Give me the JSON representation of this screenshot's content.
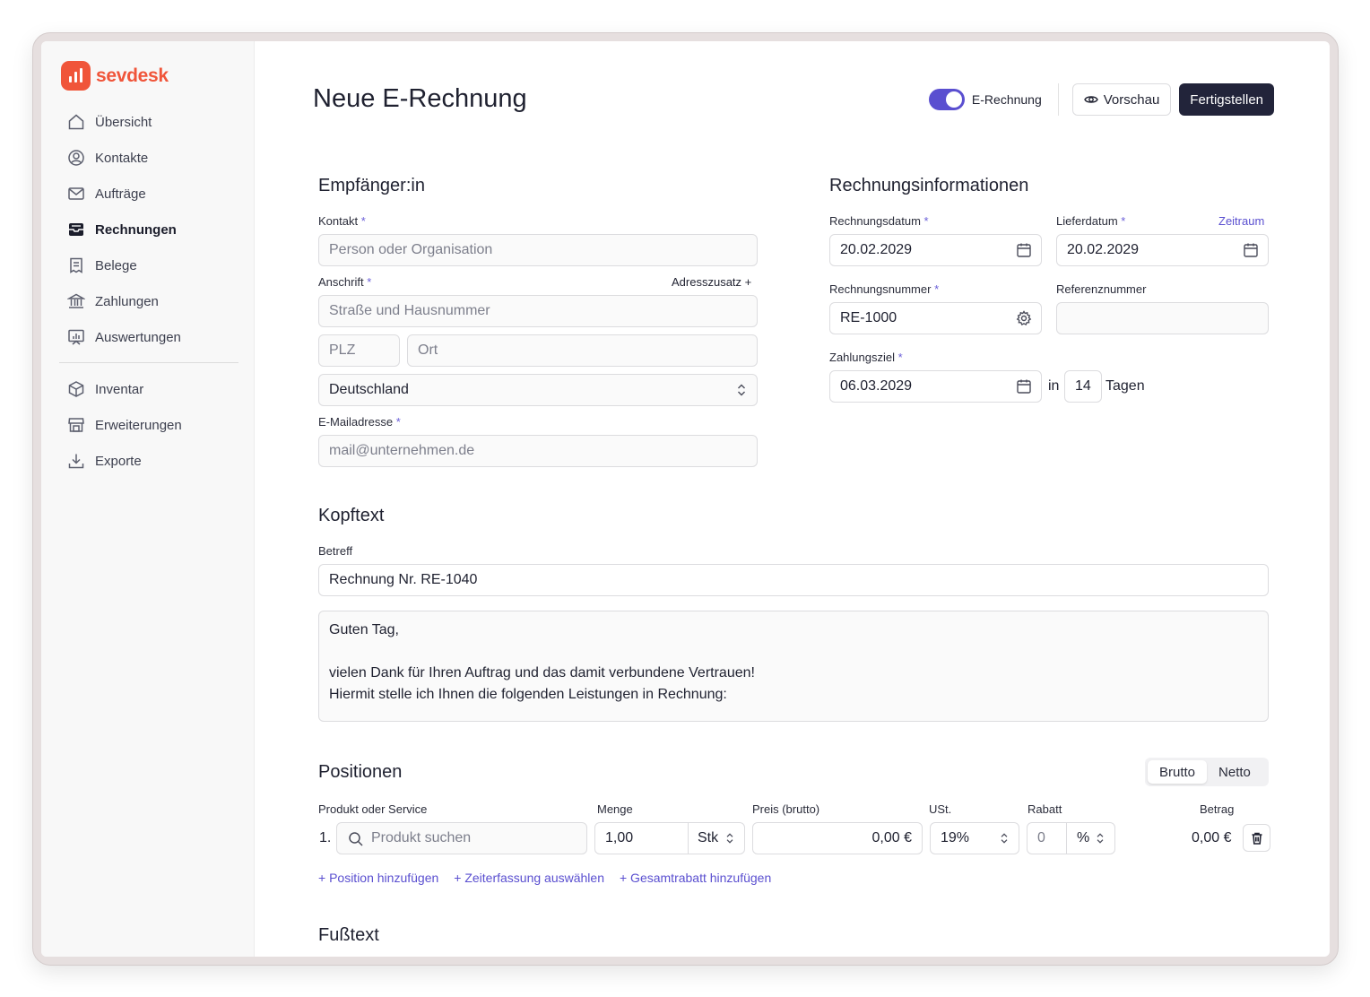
{
  "brand": {
    "name": "sevdesk",
    "color": "#f0553a"
  },
  "sidebar": {
    "items": [
      {
        "label": "Übersicht",
        "icon": "home-icon"
      },
      {
        "label": "Kontakte",
        "icon": "contact-icon"
      },
      {
        "label": "Aufträge",
        "icon": "mail-icon"
      },
      {
        "label": "Rechnungen",
        "icon": "inbox-icon",
        "active": true
      },
      {
        "label": "Belege",
        "icon": "receipt-icon"
      },
      {
        "label": "Zahlungen",
        "icon": "bank-icon"
      },
      {
        "label": "Auswertungen",
        "icon": "chart-icon"
      }
    ],
    "items2": [
      {
        "label": "Inventar",
        "icon": "box-icon"
      },
      {
        "label": "Erweiterungen",
        "icon": "store-icon"
      },
      {
        "label": "Exporte",
        "icon": "download-icon"
      }
    ]
  },
  "header": {
    "title": "Neue E-Rechnung",
    "toggle_label": "E-Rechnung",
    "toggle_on": true,
    "preview_label": "Vorschau",
    "finish_label": "Fertigstellen",
    "accent": "#5a4fd0"
  },
  "recipient": {
    "title": "Empfänger:in",
    "contact_label": "Kontakt",
    "contact_placeholder": "Person oder Organisation",
    "address_label": "Anschrift",
    "address_extra": "Adresszusatz +",
    "street_placeholder": "Straße und Hausnummer",
    "zip_placeholder": "PLZ",
    "city_placeholder": "Ort",
    "country_value": "Deutschland",
    "email_label": "E-Mailadresse",
    "email_placeholder": "mail@unternehmen.de",
    "required_mark": "*"
  },
  "invoice_info": {
    "title": "Rechnungsinformationen",
    "invoice_date_label": "Rechnungsdatum",
    "invoice_date": "20.02.2029",
    "delivery_date_label": "Lieferdatum",
    "delivery_date": "20.02.2029",
    "period_link": "Zeitraum",
    "number_label": "Rechnungsnummer",
    "number_value": "RE-1000",
    "reference_label": "Referenznummer",
    "reference_value": "",
    "due_label": "Zahlungsziel",
    "due_date": "06.03.2029",
    "in_label": "in",
    "days_value": "14",
    "days_label": "Tagen"
  },
  "header_text": {
    "title": "Kopftext",
    "subject_label": "Betreff",
    "subject_value": "Rechnung Nr. RE-1040",
    "body_line1": "Guten Tag,",
    "body_line2": "vielen Dank für Ihren Auftrag und das damit verbundene Vertrauen!",
    "body_line3": "Hiermit stelle ich Ihnen die folgenden Leistungen in Rechnung:"
  },
  "positions": {
    "title": "Positionen",
    "mode_brutto": "Brutto",
    "mode_netto": "Netto",
    "mode_selected": "Brutto",
    "col_product": "Produkt oder Service",
    "col_qty": "Menge",
    "col_price": "Preis (brutto)",
    "col_vat": "USt.",
    "col_discount": "Rabatt",
    "col_amount": "Betrag",
    "row": {
      "number": "1.",
      "product_placeholder": "Produkt suchen",
      "qty": "1,00",
      "unit": "Stk",
      "price": "0,00 €",
      "vat": "19%",
      "discount": "0",
      "discount_unit": "%",
      "amount": "0,00 €"
    },
    "add_position": "+ Position hinzufügen",
    "add_time": "+ Zeiterfassung auswählen",
    "add_discount": "+ Gesamtrabatt hinzufügen"
  },
  "footer_text": {
    "title": "Fußtext"
  }
}
